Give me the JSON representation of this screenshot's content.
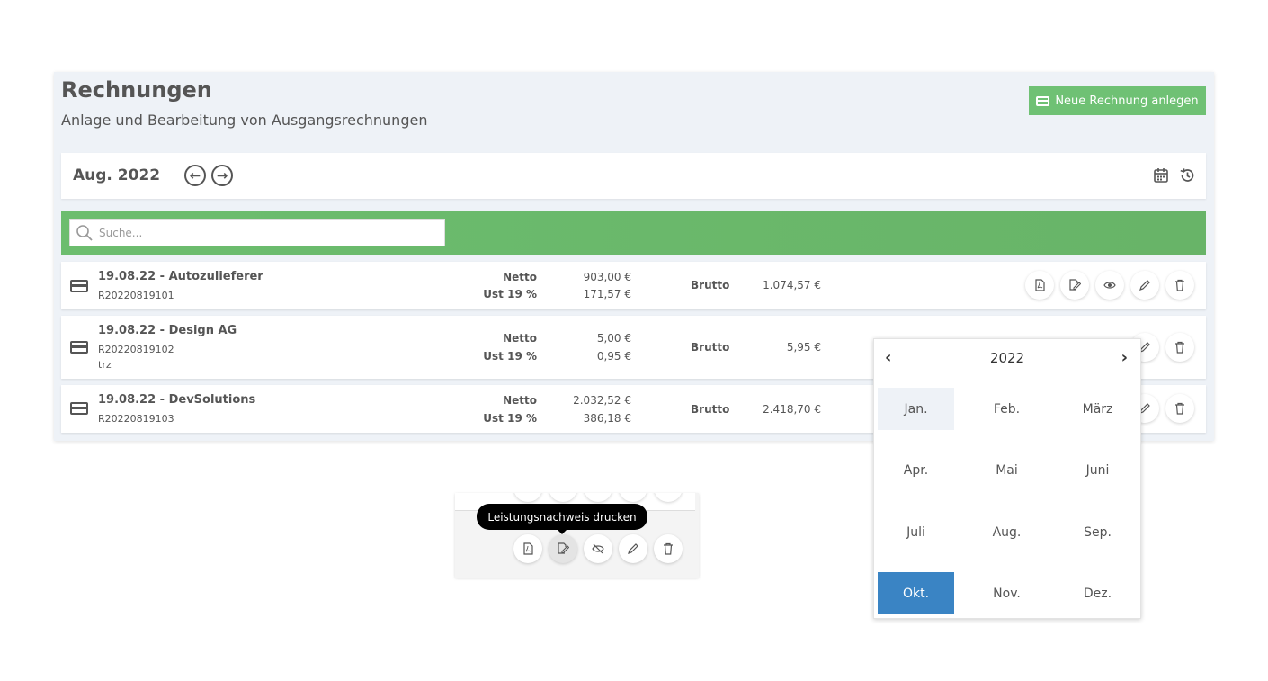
{
  "header": {
    "title": "Rechnungen",
    "subtitle": "Anlage und Bearbeitung von Ausgangsrechnungen",
    "new_button_label": "Neue Rechnung anlegen"
  },
  "month_nav": {
    "label": "Aug. 2022",
    "prev_symbol": "←",
    "next_symbol": "→",
    "icons": [
      "calendar-icon",
      "history-icon"
    ]
  },
  "search": {
    "placeholder": "Suche...",
    "value": ""
  },
  "invoices": [
    {
      "title": "19.08.22 - Autozulieferer",
      "number": "R20220819101",
      "note": "",
      "netto_label": "Netto",
      "netto": "903,00 €",
      "ust_label": "Ust 19 %",
      "ust": "171,57 €",
      "brutto_label": "Brutto",
      "brutto": "1.074,57 €"
    },
    {
      "title": "19.08.22 - Design AG",
      "number": "R20220819102",
      "note": "trz",
      "netto_label": "Netto",
      "netto": "5,00 €",
      "ust_label": "Ust 19 %",
      "ust": "0,95 €",
      "brutto_label": "Brutto",
      "brutto": "5,95 €"
    },
    {
      "title": "19.08.22 - DevSolutions",
      "number": "R20220819103",
      "note": "",
      "netto_label": "Netto",
      "netto": "2.032,52 €",
      "ust_label": "Ust 19 %",
      "ust": "386,18 €",
      "brutto_label": "Brutto",
      "brutto": "2.418,70 €"
    }
  ],
  "month_picker": {
    "year": "2022",
    "prev": "‹",
    "next": "›",
    "months": [
      "Jan.",
      "Feb.",
      "März",
      "Apr.",
      "Mai",
      "Juni",
      "Juli",
      "Aug.",
      "Sep.",
      "Okt.",
      "Nov.",
      "Dez."
    ],
    "hovered": "Jan.",
    "selected": "Okt."
  },
  "tooltip": {
    "text": "Leistungsnachweis drucken"
  },
  "colors": {
    "accent_green": "#6fc174",
    "selected_blue": "#3a84c4",
    "hover_bg": "#eef2f7"
  }
}
